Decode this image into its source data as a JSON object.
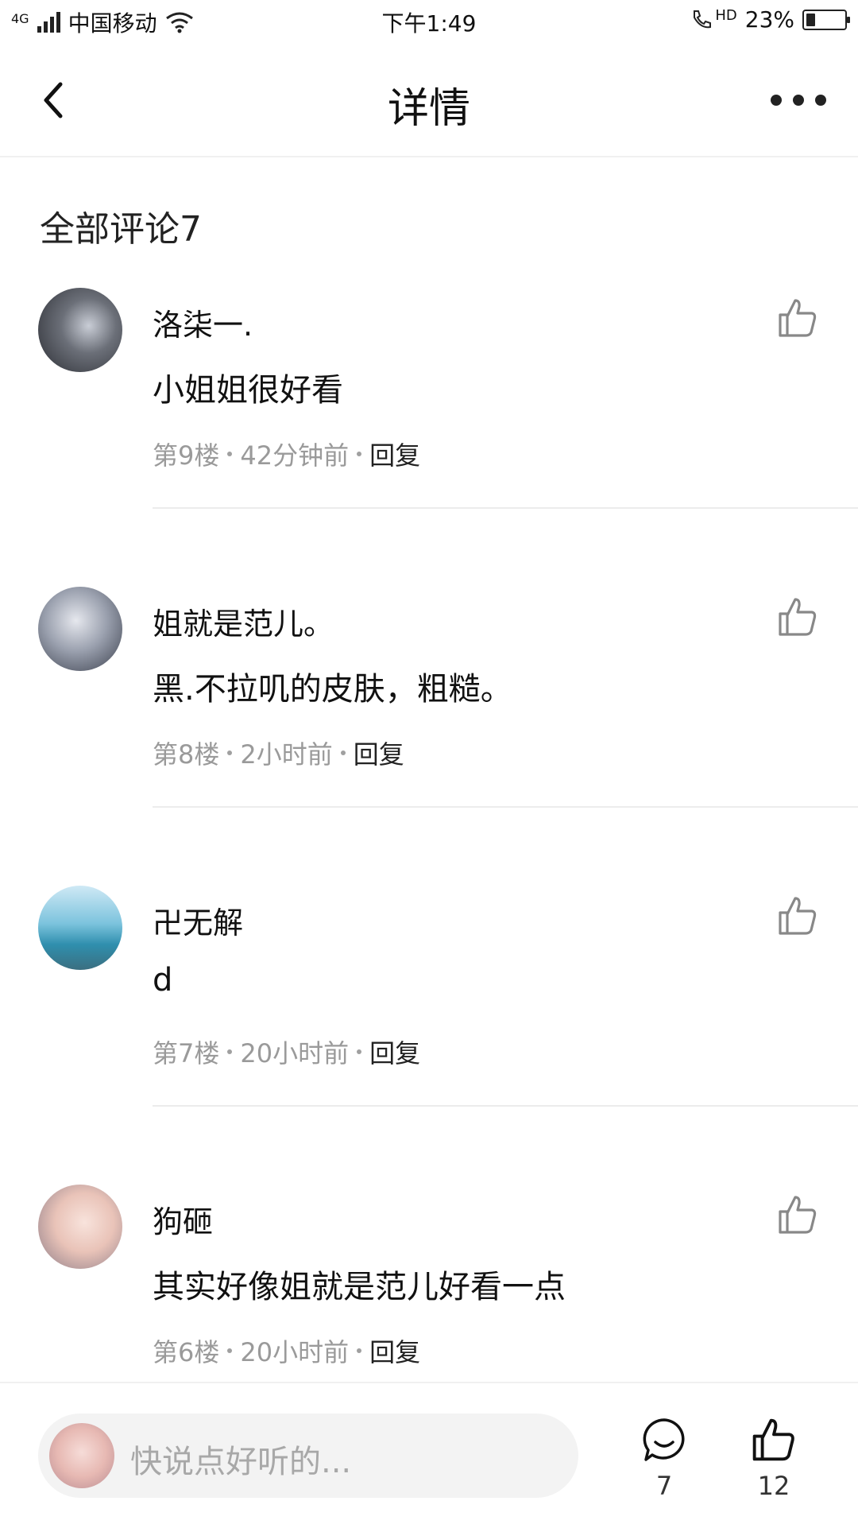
{
  "status_bar": {
    "network": "4G",
    "carrier": "中国移动",
    "time": "下午1:49",
    "hd": "HD",
    "battery": "23%",
    "battery_level": 0.23
  },
  "header": {
    "title": "详情"
  },
  "section_title": "全部评论7",
  "comments": [
    {
      "name": "洛柒一.",
      "text": "小姐姐很好看",
      "floor": "第9楼",
      "time": "42分钟前",
      "reply": "回复",
      "avatar_color": "#6b6f78"
    },
    {
      "name": "姐就是范儿。",
      "text": "黑.不拉叽的皮肤，粗糙。",
      "floor": "第8楼",
      "time": "2小时前",
      "reply": "回复",
      "avatar_color": "#8a8fa0"
    },
    {
      "name": "卍无解",
      "text": "d",
      "floor": "第7楼",
      "time": "20小时前",
      "reply": "回复",
      "avatar_color": "#4aa3c6"
    },
    {
      "name": "狗砸",
      "text": "其实好像姐就是范儿好看一点",
      "floor": "第6楼",
      "time": "20小时前",
      "reply": "回复",
      "avatar_color": "#e9c3b8"
    }
  ],
  "bottom_bar": {
    "placeholder": "快说点好听的...",
    "comment_count": "7",
    "like_count": "12"
  }
}
